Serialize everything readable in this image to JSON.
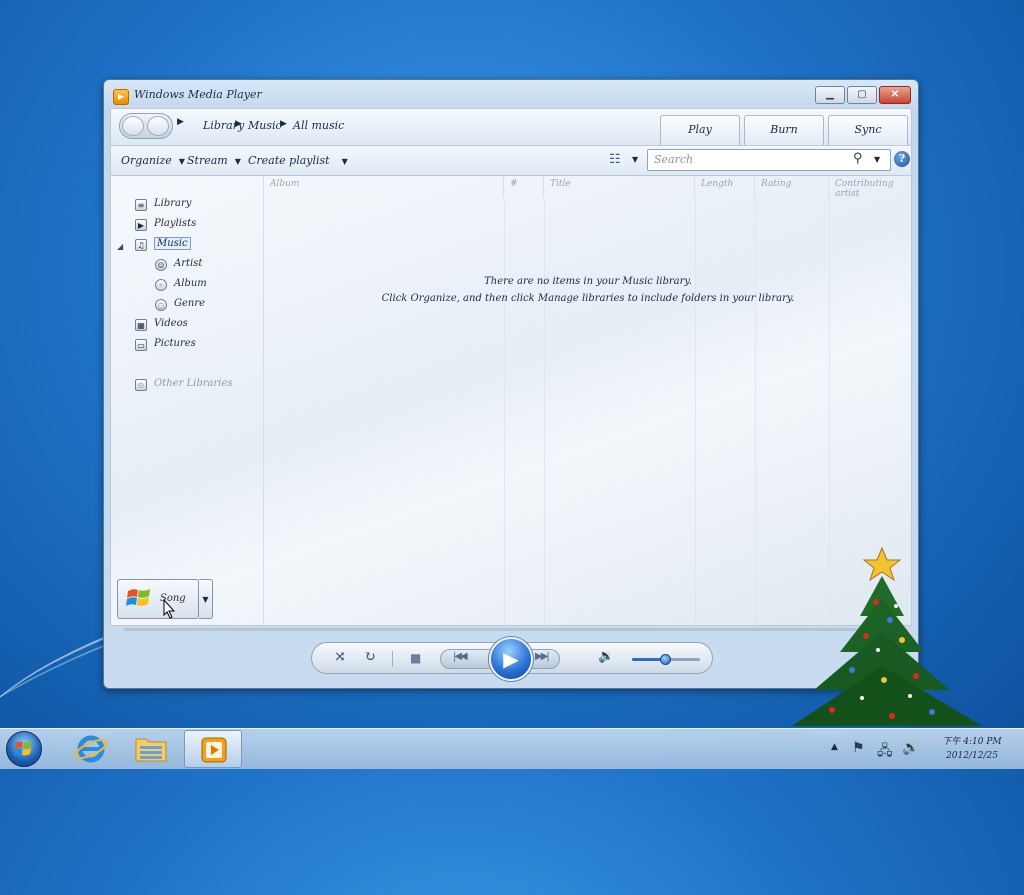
{
  "window": {
    "title": "Windows Media Player",
    "minimize_label": "▁",
    "maximize_label": "▢",
    "close_label": "✕"
  },
  "nav": {
    "breadcrumb": [
      "Library",
      "Music",
      "All music"
    ],
    "separator": "▶",
    "tabs": [
      "Play",
      "Burn",
      "Sync"
    ]
  },
  "toolbar": {
    "organize_label": "Organize",
    "stream_label": "Stream",
    "create_playlist_label": "Create playlist",
    "search_placeholder": "Search"
  },
  "sidebar": {
    "items": [
      {
        "label": "Library",
        "icon": "library-icon"
      },
      {
        "label": "Playlists",
        "icon": "playlists-icon"
      },
      {
        "label": "Music",
        "icon": "music-note-icon",
        "selected": true
      },
      {
        "label": "Artist",
        "icon": "artist-icon"
      },
      {
        "label": "Album",
        "icon": "album-icon"
      },
      {
        "label": "Genre",
        "icon": "genre-icon"
      },
      {
        "label": "Videos",
        "icon": "videos-icon"
      },
      {
        "label": "Pictures",
        "icon": "pictures-icon"
      },
      {
        "label": "Other Libraries",
        "icon": "other-libraries-icon"
      }
    ]
  },
  "list": {
    "columns": [
      "Album",
      "#",
      "Title",
      "Length",
      "Rating",
      "Contributing artist"
    ],
    "empty_line1": "There are no items in your Music library.",
    "empty_line2": "Click Organize, and then click Manage libraries to include folders in your library."
  },
  "now_playing": {
    "label": "Song"
  },
  "player": {
    "volume_percent": 50
  },
  "taskbar": {
    "clock_time": "下午 4:10 PM",
    "clock_date": "2012/12/25"
  },
  "colors": {
    "desktop_blue": "#1f74c9",
    "play_button_blue": "#2c74d6",
    "close_red": "#c8452e"
  }
}
